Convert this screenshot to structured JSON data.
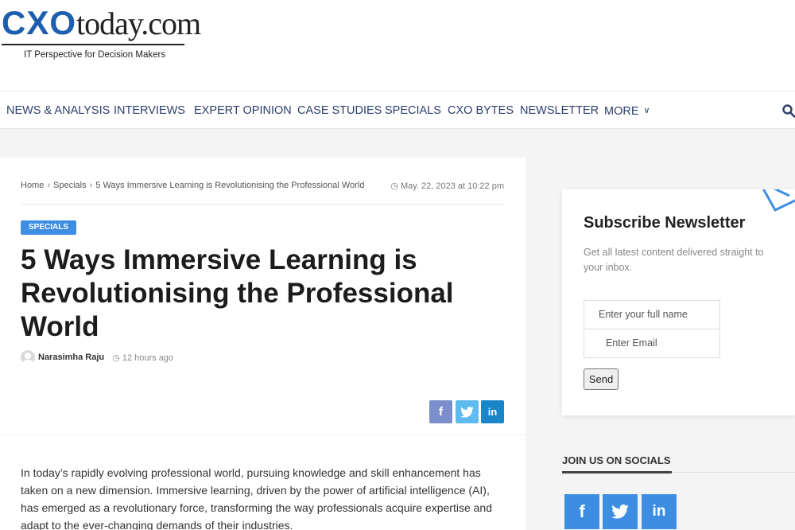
{
  "brand": {
    "logo_cxo": "CXO",
    "logo_today": "today.com",
    "tagline": "IT Perspective for Decision Makers",
    "accent_color": "#1d5fae"
  },
  "nav": {
    "items": [
      {
        "label": "NEWS & ANALYSIS"
      },
      {
        "label": "INTERVIEWS"
      },
      {
        "label": "EXPERT OPINION"
      },
      {
        "label": "CASE STUDIES"
      },
      {
        "label": "SPECIALS"
      },
      {
        "label": "CXO BYTES"
      },
      {
        "label": "NEWSLETTER"
      },
      {
        "label": "MORE"
      }
    ],
    "search_icon": "search-icon"
  },
  "article": {
    "breadcrumb": [
      "Home",
      "Specials",
      "5 Ways Immersive Learning is Revolutionising the Professional World"
    ],
    "date": "May. 22, 2023 at 10:22 pm",
    "category": "SPECIALS",
    "category_color": "#3d8ee3",
    "title": "5 Ways Immersive Learning is Revolutionising the Professional World",
    "author": "Narasimha Raju",
    "time_ago": "12 hours ago",
    "share": {
      "facebook": "f",
      "twitter": "t",
      "linkedin": "in"
    },
    "intro": "In today’s rapidly evolving professional world, pursuing knowledge and skill enhancement has taken on a new dimension. Immersive learning, driven by the power of artificial intelligence (AI), has emerged as a revolutionary force, transforming the way professionals acquire expertise and adapt to the ever-changing demands of their industries."
  },
  "newsletter": {
    "title": "Subscribe Newsletter",
    "description": "Get all latest content delivered straight to your inbox.",
    "name_placeholder": "Enter your full name",
    "email_placeholder": "Enter Email",
    "send_label": "Send"
  },
  "socials": {
    "title": "JOIN US ON SOCIALS",
    "facebook": "f",
    "twitter": "t",
    "linkedin": "in"
  }
}
